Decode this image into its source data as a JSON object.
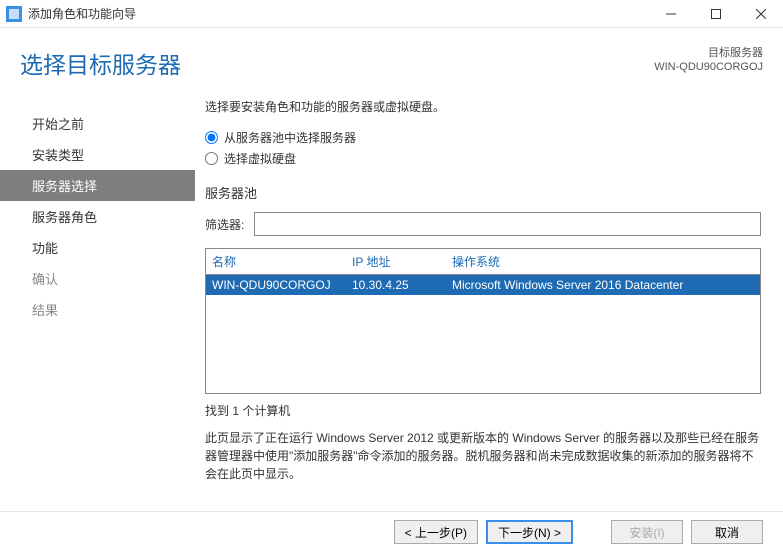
{
  "titlebar": {
    "title": "添加角色和功能向导"
  },
  "header": {
    "page_title": "选择目标服务器",
    "dest_label": "目标服务器",
    "dest_value": "WIN-QDU90CORGOJ"
  },
  "sidebar": {
    "items": [
      {
        "label": "开始之前",
        "state": "enabled"
      },
      {
        "label": "安装类型",
        "state": "enabled"
      },
      {
        "label": "服务器选择",
        "state": "active"
      },
      {
        "label": "服务器角色",
        "state": "enabled"
      },
      {
        "label": "功能",
        "state": "enabled"
      },
      {
        "label": "确认",
        "state": "disabled"
      },
      {
        "label": "结果",
        "state": "disabled"
      }
    ]
  },
  "content": {
    "instruction": "选择要安装角色和功能的服务器或虚拟硬盘。",
    "radio_pool": "从服务器池中选择服务器",
    "radio_vhd": "选择虚拟硬盘",
    "pool_label": "服务器池",
    "filter_label": "筛选器:",
    "filter_value": "",
    "columns": {
      "name": "名称",
      "ip": "IP 地址",
      "os": "操作系统"
    },
    "rows": [
      {
        "name": "WIN-QDU90CORGOJ",
        "ip": "10.30.4.25",
        "os": "Microsoft Windows Server 2016 Datacenter",
        "selected": true
      }
    ],
    "found_count": "找到 1 个计算机",
    "description": "此页显示了正在运行 Windows Server 2012 或更新版本的 Windows Server 的服务器以及那些已经在服务器管理器中使用\"添加服务器\"命令添加的服务器。脱机服务器和尚未完成数据收集的新添加的服务器将不会在此页中显示。"
  },
  "footer": {
    "prev": "< 上一步(P)",
    "next": "下一步(N) >",
    "install": "安装(I)",
    "cancel": "取消"
  }
}
